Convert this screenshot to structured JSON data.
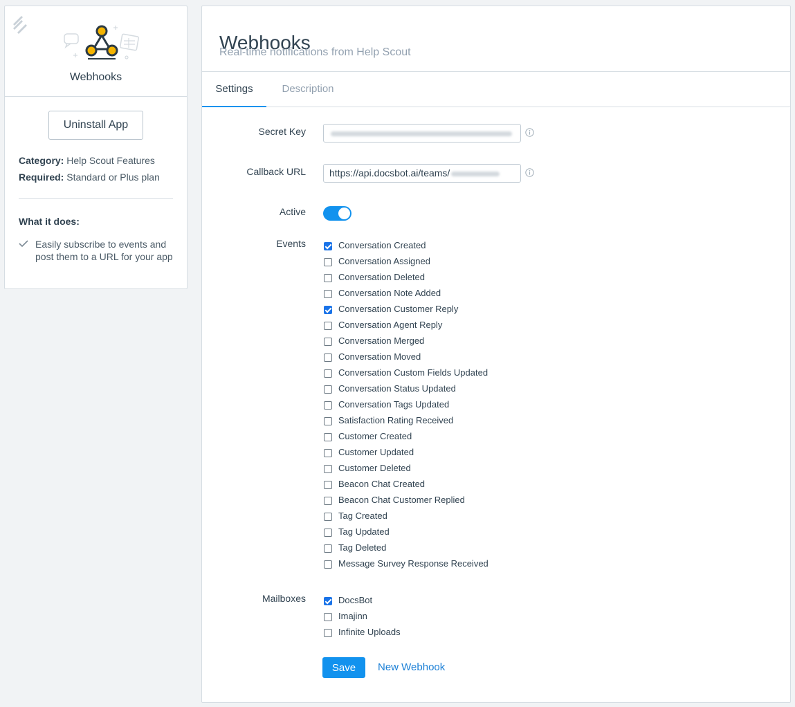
{
  "sidebar": {
    "app_name": "Webhooks",
    "uninstall_label": "Uninstall App",
    "category_label": "Category:",
    "category_value": "Help Scout Features",
    "required_label": "Required:",
    "required_value": "Standard or Plus plan",
    "what_it_does_title": "What it does:",
    "features": [
      "Easily subscribe to events and post them to a URL for your app"
    ],
    "icons": [
      "help-scout-logo-icon",
      "webhooks-app-icon",
      "checkmark-icon"
    ]
  },
  "header": {
    "title": "Webhooks",
    "subtitle": "Real-time notifications from Help Scout"
  },
  "tabs": [
    {
      "label": "Settings",
      "active": true
    },
    {
      "label": "Description",
      "active": false
    }
  ],
  "form": {
    "secret_key_label": "Secret Key",
    "callback_url_label": "Callback URL",
    "callback_url_value": "https://api.docsbot.ai/teams/",
    "active_label": "Active",
    "active": true,
    "events_label": "Events",
    "mailboxes_label": "Mailboxes"
  },
  "events": [
    {
      "label": "Conversation Created",
      "checked": true
    },
    {
      "label": "Conversation Assigned",
      "checked": false
    },
    {
      "label": "Conversation Deleted",
      "checked": false
    },
    {
      "label": "Conversation Note Added",
      "checked": false
    },
    {
      "label": "Conversation Customer Reply",
      "checked": true
    },
    {
      "label": "Conversation Agent Reply",
      "checked": false
    },
    {
      "label": "Conversation Merged",
      "checked": false
    },
    {
      "label": "Conversation Moved",
      "checked": false
    },
    {
      "label": "Conversation Custom Fields Updated",
      "checked": false
    },
    {
      "label": "Conversation Status Updated",
      "checked": false
    },
    {
      "label": "Conversation Tags Updated",
      "checked": false
    },
    {
      "label": "Satisfaction Rating Received",
      "checked": false
    },
    {
      "label": "Customer Created",
      "checked": false
    },
    {
      "label": "Customer Updated",
      "checked": false
    },
    {
      "label": "Customer Deleted",
      "checked": false
    },
    {
      "label": "Beacon Chat Created",
      "checked": false
    },
    {
      "label": "Beacon Chat Customer Replied",
      "checked": false
    },
    {
      "label": "Tag Created",
      "checked": false
    },
    {
      "label": "Tag Updated",
      "checked": false
    },
    {
      "label": "Tag Deleted",
      "checked": false
    },
    {
      "label": "Message Survey Response Received",
      "checked": false
    }
  ],
  "mailboxes": [
    {
      "label": "DocsBot",
      "checked": true
    },
    {
      "label": "Imajinn",
      "checked": false
    },
    {
      "label": "Infinite Uploads",
      "checked": false
    }
  ],
  "actions": {
    "save_label": "Save",
    "new_webhook_label": "New Webhook"
  },
  "colors": {
    "accent": "#1292ee",
    "text": "#314351",
    "muted": "#93a1b0",
    "background": "#f1f3f5",
    "logo_yellow": "#f5b400"
  }
}
